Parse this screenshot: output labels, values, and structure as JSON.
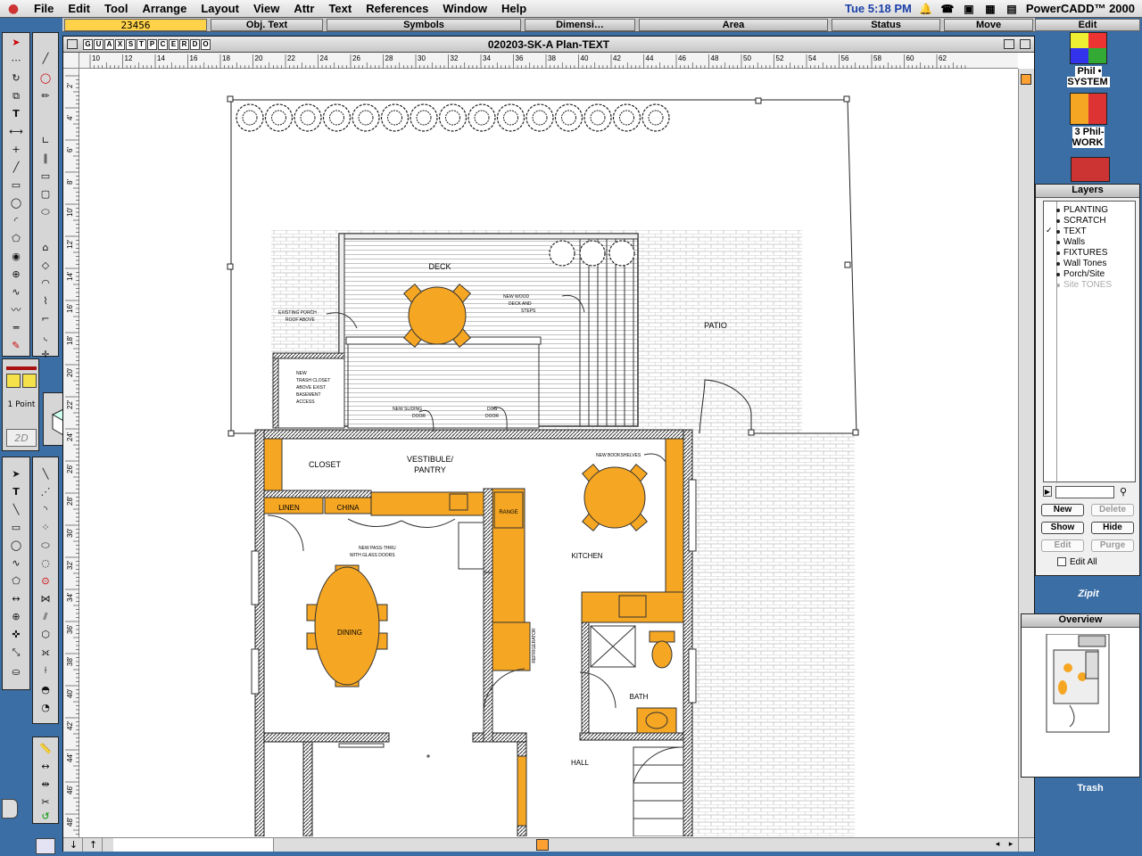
{
  "menubar": {
    "items": [
      "File",
      "Edit",
      "Tool",
      "Arrange",
      "Layout",
      "View",
      "Attr",
      "Text",
      "References",
      "Window",
      "Help"
    ],
    "clock": "Tue 5:18 PM",
    "app_name": "PowerCADD™ 2000"
  },
  "palettes": {
    "coord_value": "23456",
    "obj_text": "Obj. Text",
    "symbols": "Symbols",
    "dimensions": "Dimensi…",
    "area": "Area",
    "status": "Status",
    "move": "Move",
    "edit": "Edit"
  },
  "attributes": {
    "line_weight": "1 Point",
    "view_mode": "2D"
  },
  "document": {
    "title": "020203-SK-A Plan-TEXT",
    "tab_letters": [
      "G",
      "U",
      "A",
      "X",
      "S",
      "T",
      "P",
      "C",
      "E",
      "R",
      "D",
      "O"
    ],
    "ruler_top": [
      "10",
      "12",
      "14",
      "16",
      "18",
      "20",
      "22",
      "24",
      "26",
      "28",
      "30",
      "32",
      "34",
      "36",
      "38",
      "40",
      "42",
      "44",
      "46",
      "48",
      "50",
      "52",
      "54",
      "56",
      "58",
      "60",
      "62"
    ],
    "ruler_left": [
      "2'",
      "4'",
      "6'",
      "8'",
      "10'",
      "12'",
      "14'",
      "16'",
      "18'",
      "20'",
      "22'",
      "24'",
      "26'",
      "28'",
      "30'",
      "32'",
      "34'",
      "36'",
      "38'",
      "40'",
      "42'",
      "44'",
      "46'",
      "48'"
    ]
  },
  "plan_labels": {
    "deck": "DECK",
    "patio": "PATIO",
    "closet": "CLOSET",
    "vestibule": "VESTIBULE/",
    "pantry": "PANTRY",
    "linen": "LINEN",
    "china": "CHINA",
    "range": "RANGE",
    "kitchen": "KITCHEN",
    "dining": "DINING",
    "bath": "BATH",
    "hall": "HALL",
    "refrigerator": "REFRIGERATOR",
    "existing_porch_1": "EXISTING PORCH",
    "existing_porch_2": "ROOF ABOVE",
    "new_wood_1": "NEW WOOD",
    "new_wood_2": "DECK AND",
    "new_wood_3": "STEPS",
    "trash_1": "NEW",
    "trash_2": "TRASH CLOSET",
    "trash_3": "ABOVE EXIST",
    "trash_4": "BASEMENT",
    "trash_5": "ACCESS",
    "sliding_1": "NEW SLIDING",
    "sliding_2": "DOOR",
    "dog_1": "DOG",
    "dog_2": "DOOR",
    "bookshelves": "NEW BOOKSHELVES",
    "passthru_1": "NEW PASS-THRU",
    "passthru_2": "WITH GLASS DOORS"
  },
  "layers": {
    "title": "Layers",
    "items": [
      {
        "name": "PLANTING",
        "checked": false,
        "dimmed": false
      },
      {
        "name": "SCRATCH",
        "checked": false,
        "dimmed": false
      },
      {
        "name": "TEXT",
        "checked": true,
        "dimmed": false
      },
      {
        "name": "Walls",
        "checked": false,
        "dimmed": false
      },
      {
        "name": "FIXTURES",
        "checked": false,
        "dimmed": false
      },
      {
        "name": "Wall Tones",
        "checked": false,
        "dimmed": false
      },
      {
        "name": "Porch/Site",
        "checked": false,
        "dimmed": false
      },
      {
        "name": "Site TONES",
        "checked": false,
        "dimmed": true
      }
    ],
    "buttons": {
      "new": "New",
      "delete": "Delete",
      "show": "Show",
      "hide": "Hide",
      "edit": "Edit",
      "purge": "Purge"
    },
    "edit_all": "Edit All"
  },
  "overview": {
    "title": "Overview"
  },
  "desktop": {
    "icon1": "Phil • SYSTEM",
    "icon2": "3 Phil-WORK",
    "zipit": "Zipit",
    "trash": "Trash"
  },
  "colors": {
    "accent_orange": "#f5a623",
    "desktop_blue": "#3a6ea5",
    "coord_yellow": "#ffd24a"
  }
}
